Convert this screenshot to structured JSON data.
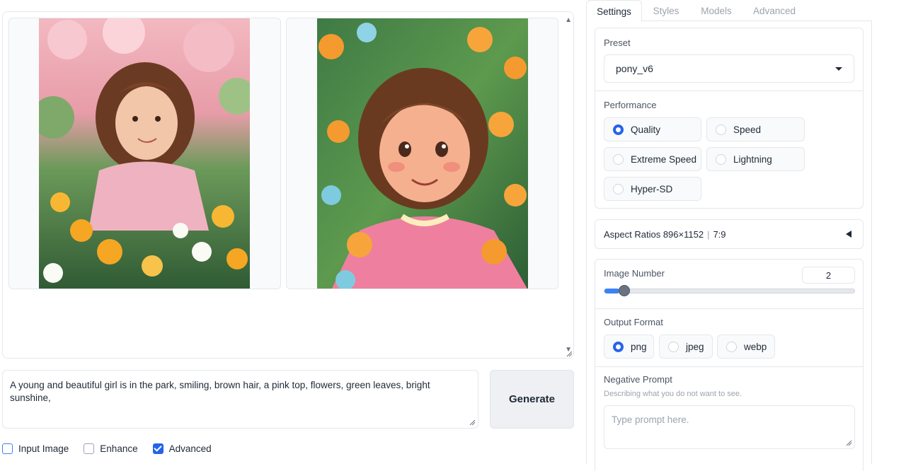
{
  "gallery": {
    "images": [
      {
        "name": "girl-in-garden-image-1"
      },
      {
        "name": "girl-in-garden-image-2"
      }
    ]
  },
  "prompt": {
    "value": "A young and beautiful girl is in the park, smiling, brown hair, a pink top, flowers, green leaves, bright sunshine,"
  },
  "generate_label": "Generate",
  "checkboxes": [
    {
      "label": "Input Image",
      "checked": false
    },
    {
      "label": "Enhance",
      "checked": false
    },
    {
      "label": "Advanced",
      "checked": true
    }
  ],
  "tabs": [
    "Settings",
    "Styles",
    "Models",
    "Advanced"
  ],
  "active_tab": "Settings",
  "preset": {
    "label": "Preset",
    "value": "pony_v6"
  },
  "performance": {
    "label": "Performance",
    "options": [
      "Quality",
      "Speed",
      "Extreme Speed",
      "Lightning",
      "Hyper-SD"
    ],
    "selected": "Quality"
  },
  "aspect_ratios": {
    "label": "Aspect Ratios 896×1152",
    "ratio": "7:9"
  },
  "image_number": {
    "label": "Image Number",
    "value": "2",
    "fraction": 0.06
  },
  "output_format": {
    "label": "Output Format",
    "options": [
      "png",
      "jpeg",
      "webp"
    ],
    "selected": "png"
  },
  "negative_prompt": {
    "label": "Negative Prompt",
    "hint": "Describing what you do not want to see.",
    "placeholder": "Type prompt here."
  },
  "colors": {
    "accent": "#2563eb"
  }
}
